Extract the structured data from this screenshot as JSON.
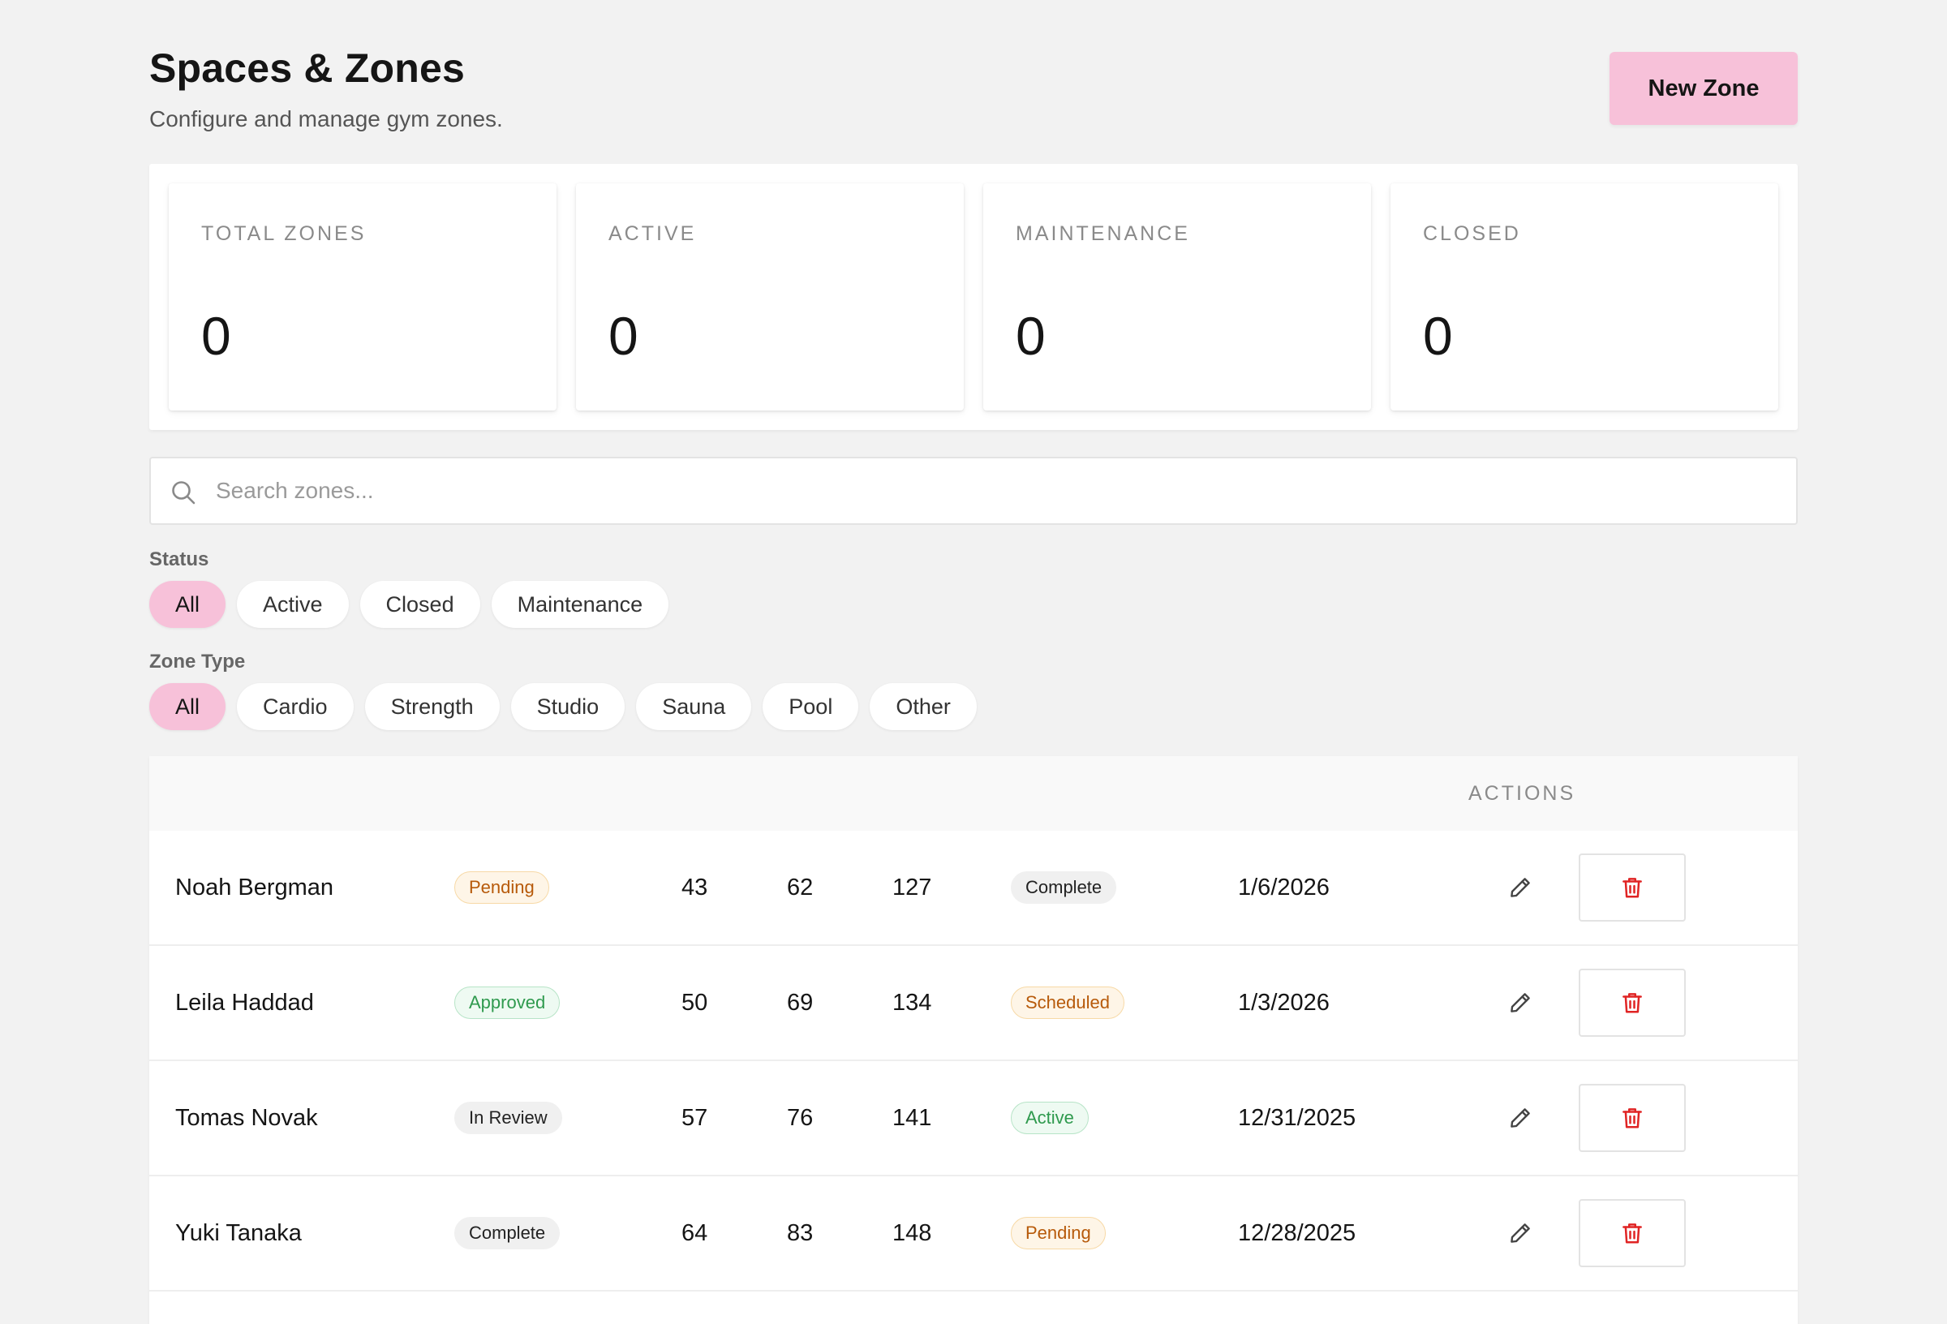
{
  "header": {
    "title": "Spaces & Zones",
    "subtitle": "Configure and manage gym zones.",
    "new_zone_label": "New Zone"
  },
  "stats": [
    {
      "label": "TOTAL ZONES",
      "value": "0"
    },
    {
      "label": "ACTIVE",
      "value": "0"
    },
    {
      "label": "MAINTENANCE",
      "value": "0"
    },
    {
      "label": "CLOSED",
      "value": "0"
    }
  ],
  "search": {
    "placeholder": "Search zones...",
    "value": "",
    "icon": "search-icon"
  },
  "filters": {
    "status": {
      "label": "Status",
      "options": [
        "All",
        "Active",
        "Closed",
        "Maintenance"
      ],
      "selected": "All"
    },
    "zone_type": {
      "label": "Zone Type",
      "options": [
        "All",
        "Cardio",
        "Strength",
        "Studio",
        "Sauna",
        "Pool",
        "Other"
      ],
      "selected": "All"
    }
  },
  "table": {
    "actions_header": "ACTIONS",
    "rows": [
      {
        "name": "Noah Bergman",
        "status": "Pending",
        "n1": "43",
        "n2": "62",
        "n3": "127",
        "state": "Complete",
        "date": "1/6/2026"
      },
      {
        "name": "Leila Haddad",
        "status": "Approved",
        "n1": "50",
        "n2": "69",
        "n3": "134",
        "state": "Scheduled",
        "date": "1/3/2026"
      },
      {
        "name": "Tomas Novak",
        "status": "In Review",
        "n1": "57",
        "n2": "76",
        "n3": "141",
        "state": "Active",
        "date": "12/31/2025"
      },
      {
        "name": "Yuki Tanaka",
        "status": "Complete",
        "n1": "64",
        "n2": "83",
        "n3": "148",
        "state": "Pending",
        "date": "12/28/2025"
      }
    ]
  },
  "colors": {
    "accent": "#f7c1d9",
    "background": "#f2f2f2",
    "danger": "#e02424",
    "amber_text": "#b75a0a",
    "green_text": "#2f9a4e"
  },
  "icons": {
    "edit": "pencil-icon",
    "delete": "trash-icon"
  }
}
